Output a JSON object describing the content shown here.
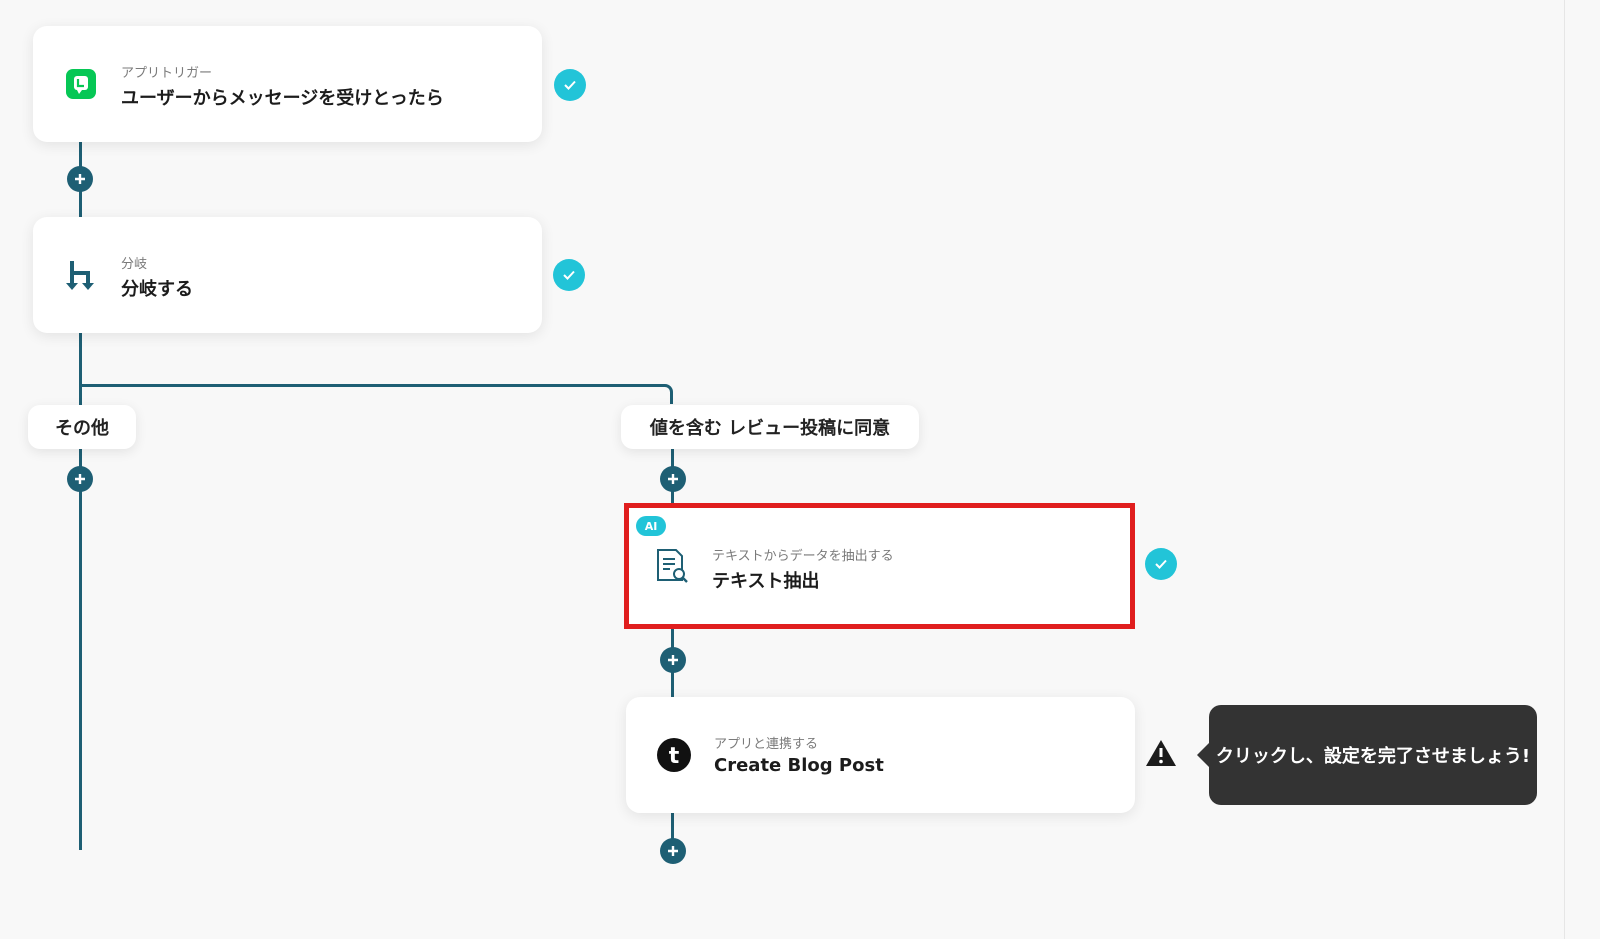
{
  "nodes": {
    "trigger": {
      "sub": "アプリトリガー",
      "title": "ユーザーからメッセージを受けとったら",
      "icon": "line-app-icon",
      "status": "complete"
    },
    "branch": {
      "sub": "分岐",
      "title": "分岐する",
      "icon": "branch-icon",
      "status": "complete"
    },
    "extract": {
      "badge": "AI",
      "sub": "テキストからデータを抽出する",
      "title": "テキスト抽出",
      "icon": "document-search-icon",
      "status": "complete"
    },
    "tumblr": {
      "sub": "アプリと連携する",
      "title": "Create Blog Post",
      "icon": "tumblr-icon",
      "status": "warning"
    }
  },
  "branches": {
    "other_label": "その他",
    "condition_label": "値を含む レビュー投稿に同意"
  },
  "tooltip": {
    "text": "クリックし、設定を完了させましょう!"
  },
  "colors": {
    "line": "#1e5f74",
    "check": "#22c4d8",
    "highlight": "#e01e1e",
    "line_app": "#06c755"
  }
}
